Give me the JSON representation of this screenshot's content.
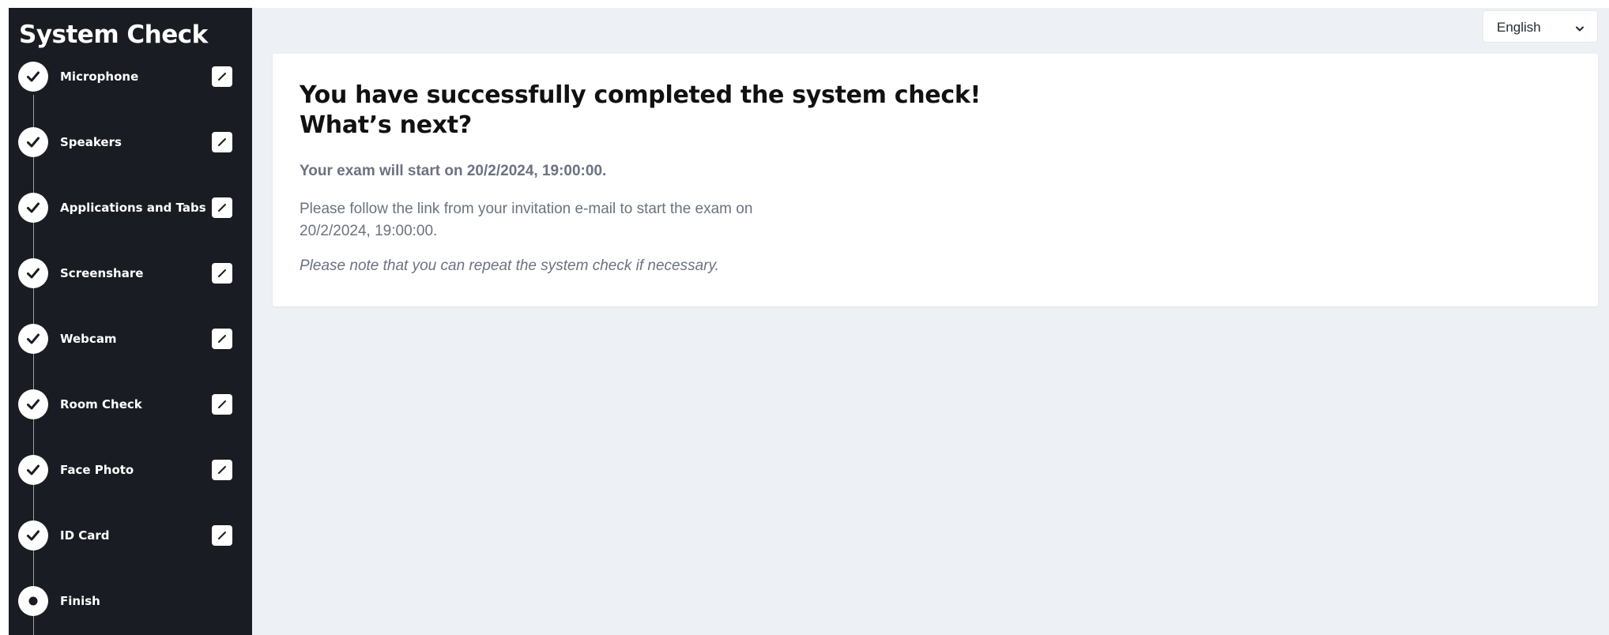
{
  "sidebar": {
    "title": "System Check",
    "steps": [
      {
        "label": "Microphone",
        "status": "completed",
        "icon": "check-icon",
        "edit_icon": "edit-pencil-icon"
      },
      {
        "label": "Speakers",
        "status": "completed",
        "icon": "check-icon",
        "edit_icon": "edit-pencil-icon"
      },
      {
        "label": "Applications and Tabs",
        "status": "completed",
        "icon": "check-icon",
        "edit_icon": "edit-pencil-icon"
      },
      {
        "label": "Screenshare",
        "status": "completed",
        "icon": "check-icon",
        "edit_icon": "edit-pencil-icon"
      },
      {
        "label": "Webcam",
        "status": "completed",
        "icon": "check-icon",
        "edit_icon": "edit-pencil-icon"
      },
      {
        "label": "Room Check",
        "status": "completed",
        "icon": "check-icon",
        "edit_icon": "edit-pencil-icon"
      },
      {
        "label": "Face Photo",
        "status": "completed",
        "icon": "check-icon",
        "edit_icon": "edit-pencil-icon"
      },
      {
        "label": "ID Card",
        "status": "completed",
        "icon": "check-icon",
        "edit_icon": "edit-pencil-icon"
      },
      {
        "label": "Finish",
        "status": "current",
        "icon": "current-dot-icon"
      }
    ]
  },
  "language": {
    "selected": "English",
    "icon": "chevron-down-icon"
  },
  "main": {
    "title_line1": "You have successfully completed the system check!",
    "title_line2": "What’s next?",
    "start_date": "Your exam will start on 20/2/2024, 19:00:00.",
    "instructions": "Please follow the link from your invitation e-mail to start the exam on 20/2/2024, 19:00:00.",
    "note": "Please note that you can repeat the system check if necessary."
  },
  "colors": {
    "sidebar_bg": "#1a1c23",
    "page_bg": "#edf1f5",
    "card_bg": "#ffffff",
    "muted_text": "#6b7280"
  }
}
